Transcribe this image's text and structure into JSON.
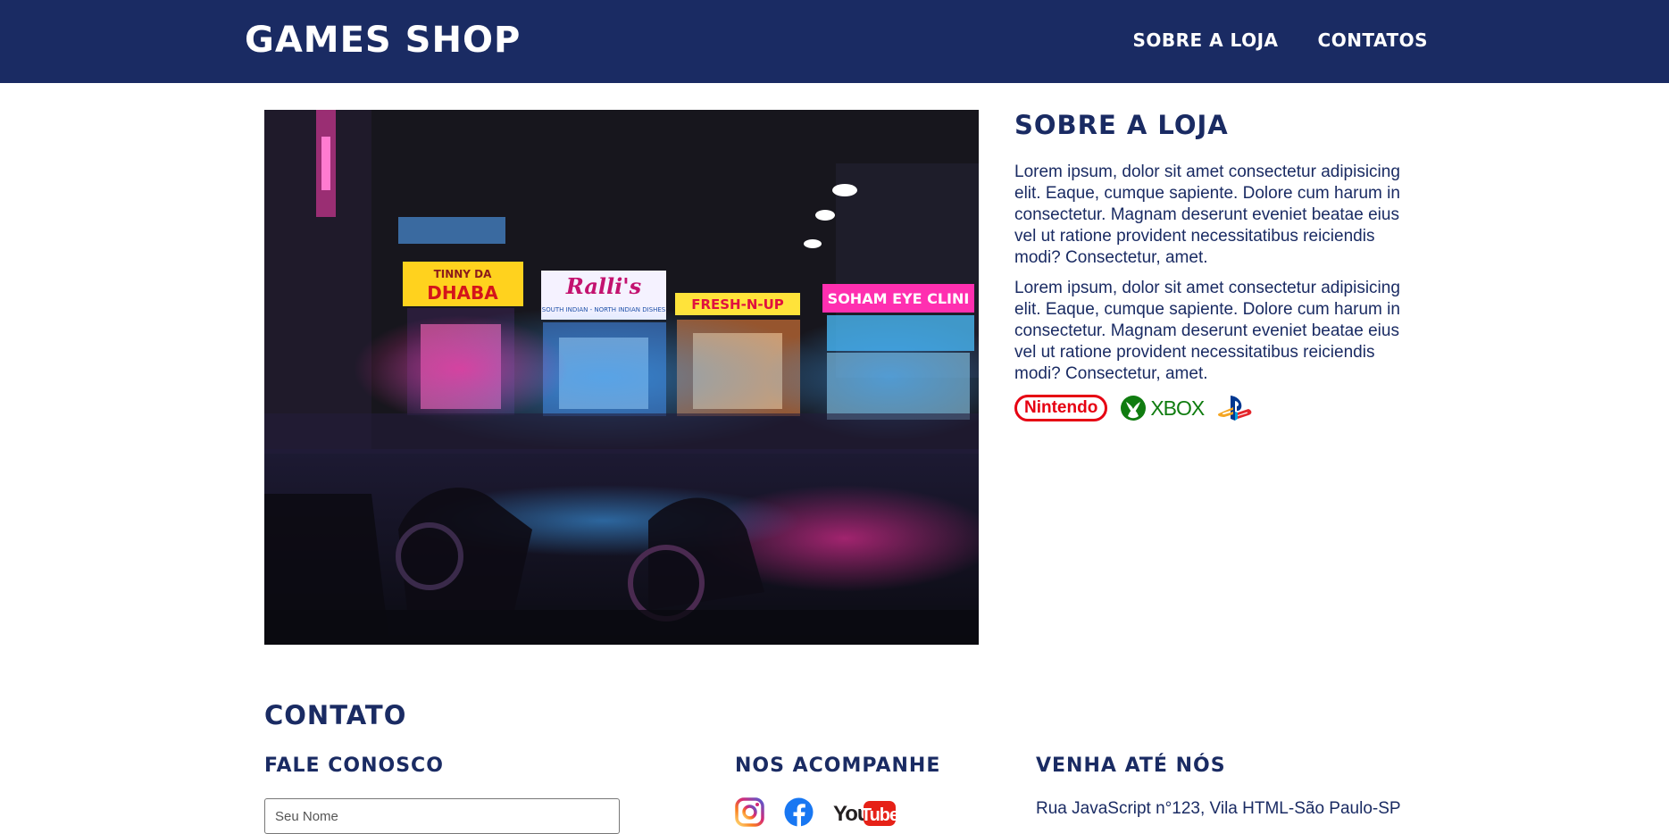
{
  "header": {
    "logo": "GAMES SHOP",
    "nav": [
      "SOBRE A LOJA",
      "CONTATOS"
    ]
  },
  "about": {
    "title": "SOBRE A LOJA",
    "paragraphs": [
      "Lorem ipsum, dolor sit amet consectetur adipisicing elit. Eaque, cumque sapiente. Dolore cum harum in consectetur. Magnam deserunt eveniet beatae eius vel ut ratione provident necessitatibus reiciendis modi? Consectetur, amet.",
      "Lorem ipsum, dolor sit amet consectetur adipisicing elit. Eaque, cumque sapiente. Dolore cum harum in consectetur. Magnam deserunt eveniet beatae eius vel ut ratione provident necessitatibus reiciendis modi? Consectetur, amet."
    ],
    "brands": {
      "nintendo": "Nintendo",
      "xbox": "XBOX",
      "playstation_icon": "playstation-logo"
    }
  },
  "hero": {
    "signs": [
      "TINNY DA",
      "DHABA",
      "Ralli's",
      "SOUTH INDIAN - NORTH INDIAN DISHES",
      "FRESH-N-UP",
      "SOHAM EYE CLINI"
    ]
  },
  "contact": {
    "title": "CONTATO",
    "form": {
      "title": "FALE CONOSCO",
      "name_placeholder": "Seu Nome"
    },
    "social": {
      "title": "NOS ACOMPANHE",
      "icons": [
        "instagram-icon",
        "facebook-icon",
        "youtube-icon"
      ],
      "youtube_text_you": "You",
      "youtube_text_tube": "Tube"
    },
    "location": {
      "title": "VENHA ATÉ NÓS",
      "address": "Rua JavaScript n°123, Vila HTML-São Paulo-SP"
    }
  },
  "colors": {
    "primary": "#1a2b63",
    "nintendo_red": "#e60012",
    "xbox_green": "#107c10",
    "background": "#ffffff"
  }
}
